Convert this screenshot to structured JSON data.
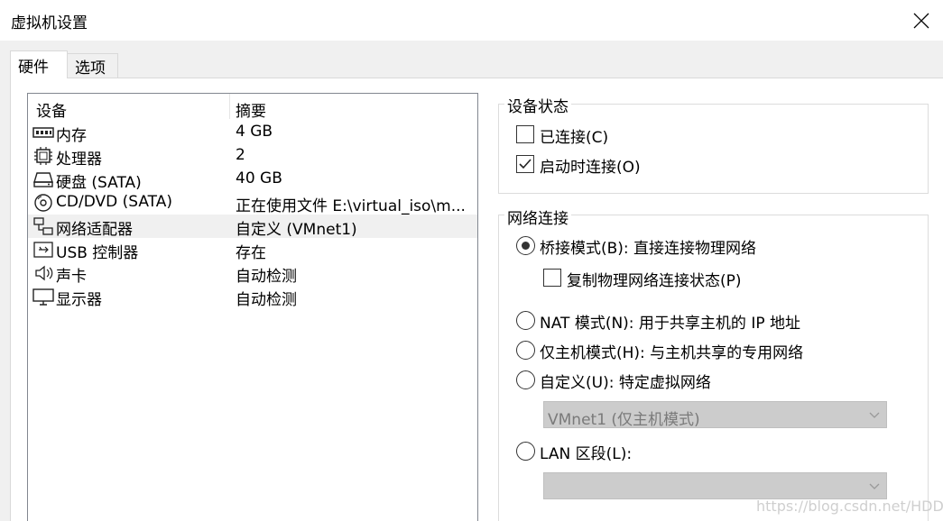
{
  "window": {
    "title": "虚拟机设置",
    "close_icon": "close-icon"
  },
  "tabs": [
    {
      "label": "硬件",
      "active": true
    },
    {
      "label": "选项",
      "active": false
    }
  ],
  "device_list": {
    "columns": [
      "设备",
      "摘要"
    ],
    "rows": [
      {
        "icon": "memory-icon",
        "device": "内存",
        "summary": "4 GB"
      },
      {
        "icon": "cpu-icon",
        "device": "处理器",
        "summary": "2"
      },
      {
        "icon": "harddisk-icon",
        "device": "硬盘 (SATA)",
        "summary": "40 GB"
      },
      {
        "icon": "cd-icon",
        "device": "CD/DVD (SATA)",
        "summary": "正在使用文件 E:\\virtual_iso\\m..."
      },
      {
        "icon": "network-icon",
        "device": "网络适配器",
        "summary": "自定义 (VMnet1)",
        "selected": true
      },
      {
        "icon": "usb-icon",
        "device": "USB 控制器",
        "summary": "存在"
      },
      {
        "icon": "speaker-icon",
        "device": "声卡",
        "summary": "自动检测"
      },
      {
        "icon": "monitor-icon",
        "device": "显示器",
        "summary": "自动检测"
      }
    ]
  },
  "device_status": {
    "title": "设备状态",
    "connected": {
      "label": "已连接(C)",
      "checked": false
    },
    "connect_at_power_on": {
      "label": "启动时连接(O)",
      "checked": true
    }
  },
  "network_connection": {
    "title": "网络连接",
    "bridged": {
      "label": "桥接模式(B): 直接连接物理网络",
      "selected": true
    },
    "replicate": {
      "label": "复制物理网络连接状态(P)",
      "checked": false
    },
    "nat": {
      "label": "NAT 模式(N): 用于共享主机的 IP 地址",
      "selected": false
    },
    "host_only": {
      "label": "仅主机模式(H): 与主机共享的专用网络",
      "selected": false
    },
    "custom": {
      "label": "自定义(U): 特定虚拟网络",
      "selected": false
    },
    "custom_select": {
      "value": "VMnet1 (仅主机模式)"
    },
    "lan_segment": {
      "label": "LAN 区段(L):",
      "selected": false
    },
    "lan_select": {
      "value": ""
    }
  },
  "watermark": "https://blog.csdn.net/HDD_jf"
}
